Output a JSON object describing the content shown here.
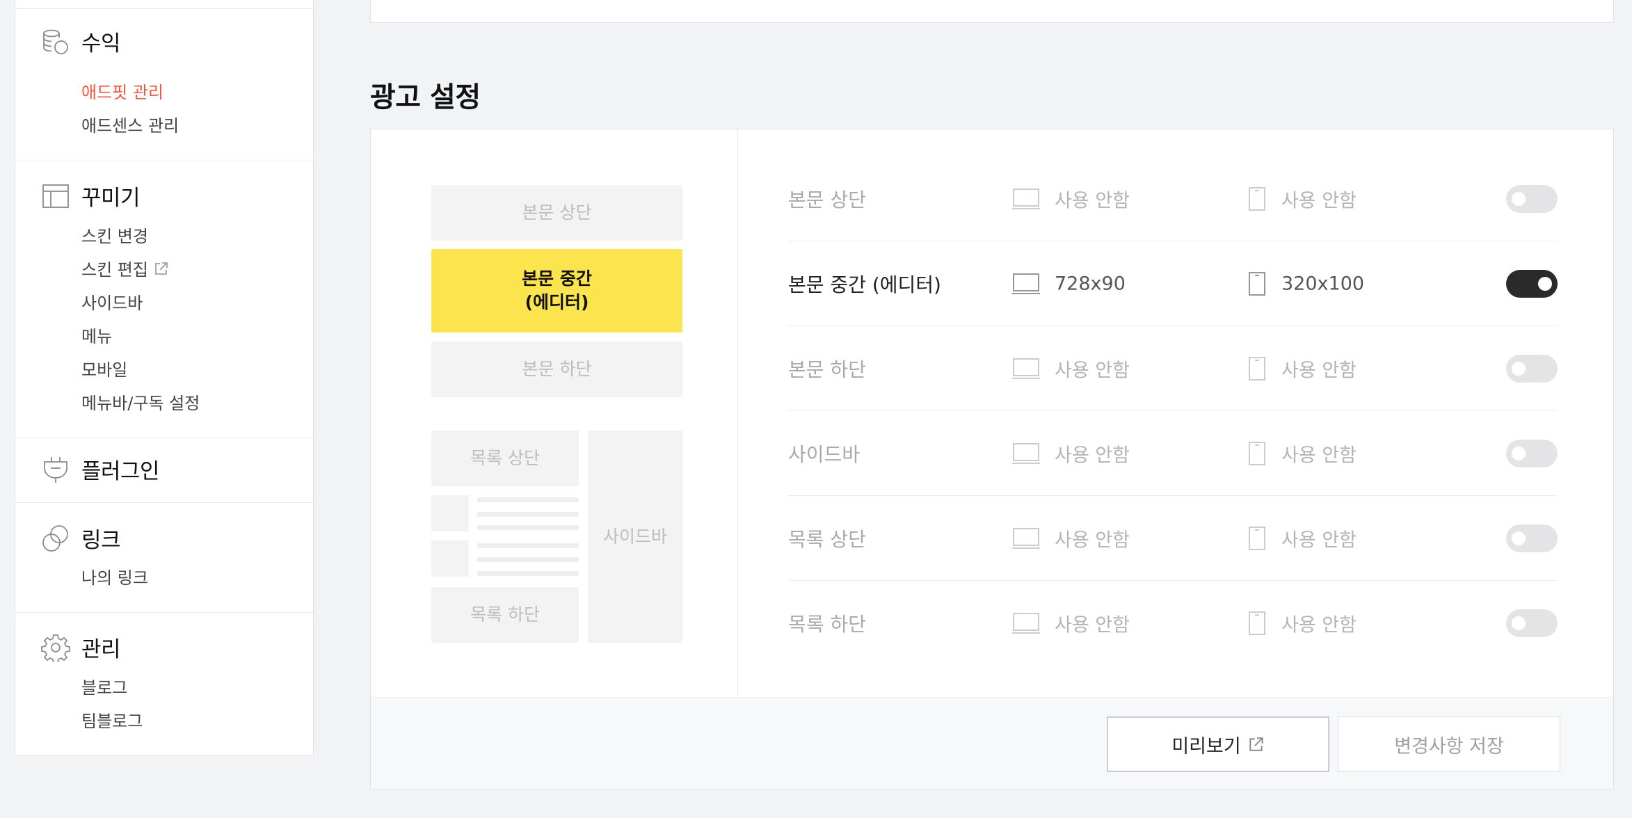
{
  "sidebar": {
    "groups": [
      {
        "title": "수익",
        "icon": "coins-icon",
        "items": [
          "애드핏 관리",
          "애드센스 관리"
        ],
        "active_item": "애드핏 관리"
      },
      {
        "title": "꾸미기",
        "icon": "layout-icon",
        "items": [
          "스킨 변경",
          "스킨 편집",
          "사이드바",
          "메뉴",
          "모바일",
          "메뉴바/구독 설정"
        ],
        "external_item": "스킨 편집"
      },
      {
        "title": "플러그인",
        "icon": "plug-icon",
        "items": []
      },
      {
        "title": "링크",
        "icon": "link-icon",
        "items": [
          "나의 링크"
        ]
      },
      {
        "title": "관리",
        "icon": "gear-icon",
        "items": [
          "블로그",
          "팀블로그"
        ]
      }
    ]
  },
  "main": {
    "section_title": "광고 설정",
    "preview": {
      "body_top": "본문 상단",
      "body_middle_line1": "본문 중간",
      "body_middle_line2": "(에디터)",
      "body_bottom": "본문 하단",
      "list_top": "목록 상단",
      "list_bottom": "목록 하단",
      "sidebar": "사이드바",
      "active": "body_middle"
    },
    "rows": [
      {
        "label": "본문 상단",
        "pc": "사용 안함",
        "mobile": "사용 안함",
        "enabled": false
      },
      {
        "label": "본문 중간 (에디터)",
        "pc": "728x90",
        "mobile": "320x100",
        "enabled": true
      },
      {
        "label": "본문 하단",
        "pc": "사용 안함",
        "mobile": "사용 안함",
        "enabled": false
      },
      {
        "label": "사이드바",
        "pc": "사용 안함",
        "mobile": "사용 안함",
        "enabled": false
      },
      {
        "label": "목록 상단",
        "pc": "사용 안함",
        "mobile": "사용 안함",
        "enabled": false
      },
      {
        "label": "목록 하단",
        "pc": "사용 안함",
        "mobile": "사용 안함",
        "enabled": false
      }
    ],
    "buttons": {
      "preview": "미리보기",
      "save": "변경사항 저장"
    }
  },
  "colors": {
    "accent_active": "#f0573f",
    "highlight_yellow": "#fbe44d",
    "toggle_on": "#2b2b2b",
    "toggle_off": "#e4e4e6"
  }
}
